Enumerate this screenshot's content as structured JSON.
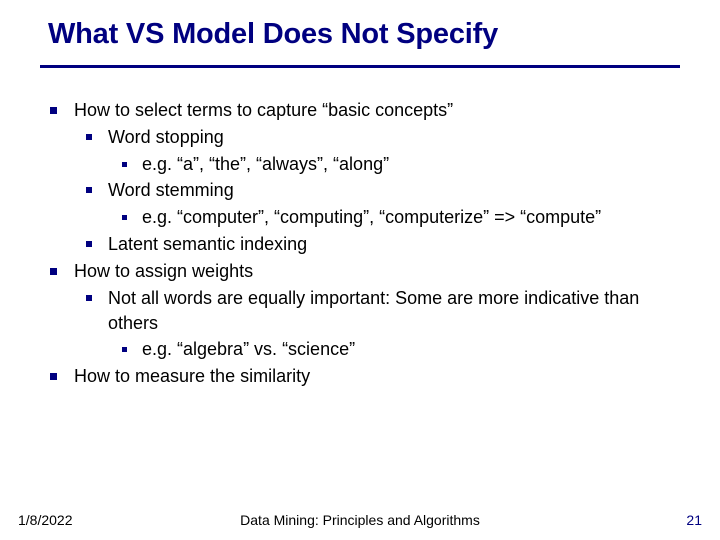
{
  "slide": {
    "title": "What VS Model Does Not Specify",
    "bullets": {
      "b1": "How to select terms to capture “basic concepts”",
      "b1_1": "Word stopping",
      "b1_1_1": "e.g. “a”, “the”, “always”, “along”",
      "b1_2": "Word stemming",
      "b1_2_1": "e.g. “computer”, “computing”, “computerize” => “compute”",
      "b1_3": "Latent semantic indexing",
      "b2": "How to assign weights",
      "b2_1": "Not all words are equally important: Some are more indicative than others",
      "b2_1_1": "e.g. “algebra” vs. “science”",
      "b3": "How to measure the similarity"
    }
  },
  "footer": {
    "date": "1/8/2022",
    "center": "Data Mining: Principles and Algorithms",
    "page": "21"
  }
}
